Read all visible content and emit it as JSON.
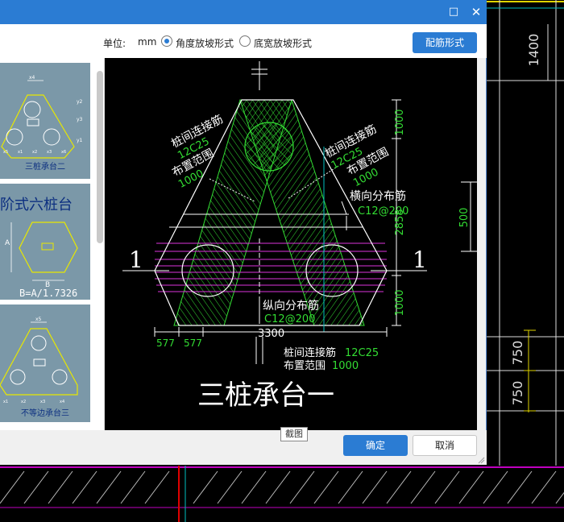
{
  "window": {
    "minimize_icon": "minimize-icon",
    "close_icon": "close-icon"
  },
  "toolbar": {
    "unit_label": "单位:",
    "unit_value": "mm",
    "options": [
      {
        "label": "角度放坡形式",
        "checked": true
      },
      {
        "label": "底宽放坡形式",
        "checked": false
      }
    ],
    "rebar_button": "配筋形式"
  },
  "thumbnails": [
    {
      "caption": "三桩承台二",
      "dims": [
        "x4",
        "y2",
        "y3",
        "y1",
        "x5",
        "x1",
        "x2",
        "x3",
        "x6"
      ]
    },
    {
      "title": "阶式六桩台",
      "formula": "B=A/1.7326",
      "dims": [
        "A",
        "B"
      ]
    },
    {
      "caption": "不等边承台三",
      "dims": [
        "x5",
        "x1",
        "x2",
        "x3",
        "x4"
      ]
    }
  ],
  "drawing": {
    "title": "三桩承台一",
    "section_marks": [
      "1",
      "1"
    ],
    "labels": {
      "left_link_a": "桩间连接筋",
      "left_link_b": "12C25",
      "left_range_a": "布置范围",
      "left_range_b": "1000",
      "right_link_a": "桩间连接筋",
      "right_link_b": "12C25",
      "right_range_a": "布置范围",
      "right_range_b": "1000",
      "transverse_a": "横向分布筋",
      "transverse_b": "C12@200",
      "longitudinal_a": "纵向分布筋",
      "longitudinal_b": "C12@200",
      "bottom_link_a": "桩间连接筋",
      "bottom_link_b": "12C25",
      "bottom_range_a": "布置范围",
      "bottom_range_b": "1000"
    },
    "dims": {
      "top": "1000",
      "middle": "2858",
      "bottom": "1000",
      "side": "500",
      "width": "3300",
      "edge_left": "577",
      "edge_right": "577"
    }
  },
  "background": {
    "dims": [
      "1400",
      "750",
      "750"
    ]
  },
  "footer": {
    "ok": "确定",
    "cancel": "取消",
    "tooltip": "截图"
  }
}
